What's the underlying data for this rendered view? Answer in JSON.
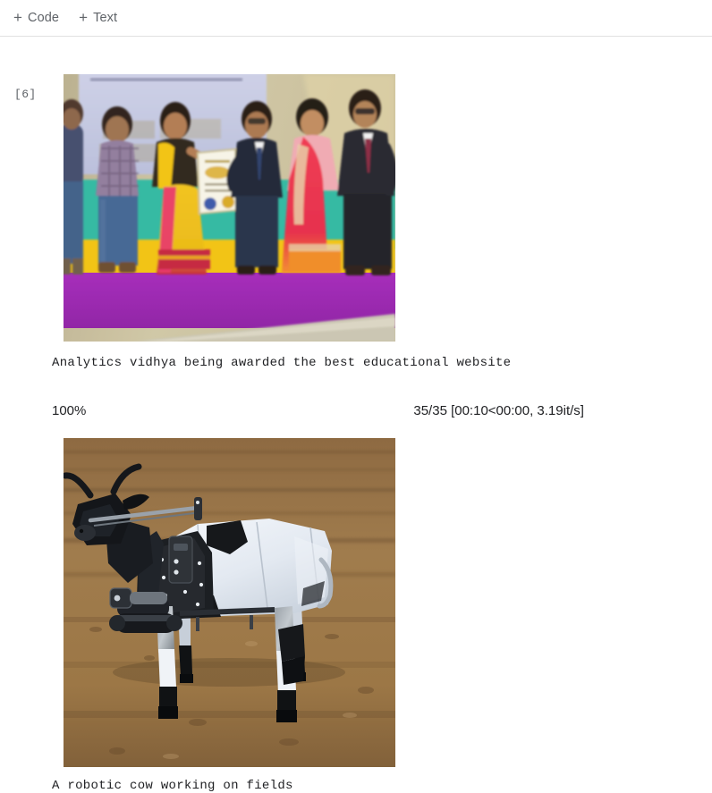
{
  "toolbar": {
    "add_code_label": "Code",
    "add_text_label": "Text",
    "plus_glyph": "+"
  },
  "cell": {
    "execution_label": "[6]"
  },
  "outputs": [
    {
      "type": "image",
      "name": "award-ceremony-photo",
      "alt": "Group of people on stage holding an award certificate"
    },
    {
      "type": "text",
      "name": "award-caption",
      "text": "Analytics vidhya being awarded the best educational website"
    },
    {
      "type": "progress",
      "name": "tqdm-progress",
      "percent_label": "100%",
      "percent_value": 100,
      "stats_label": "35/35 [00:10<00:00, 3.19it/s]",
      "current": 35,
      "total": 35,
      "elapsed": "00:10",
      "remaining": "00:00",
      "rate": "3.19it/s",
      "bar_color": "#4caf50"
    },
    {
      "type": "image",
      "name": "robotic-cow-photo",
      "alt": "A white and black robotic cow standing on a bare dirt field"
    },
    {
      "type": "text",
      "name": "cow-caption",
      "text": "A robotic cow working on fields"
    }
  ],
  "captions": {
    "award": "Analytics vidhya being awarded the best educational website",
    "cow": "A robotic cow working on fields"
  },
  "progress": {
    "percent_label": "100%",
    "stats_label": "35/35 [00:10<00:00, 3.19it/s]"
  },
  "colors": {
    "progress_green": "#4caf50",
    "toolbar_text": "#5f6368",
    "body_text": "#202124",
    "divider": "#e0e0e0"
  }
}
